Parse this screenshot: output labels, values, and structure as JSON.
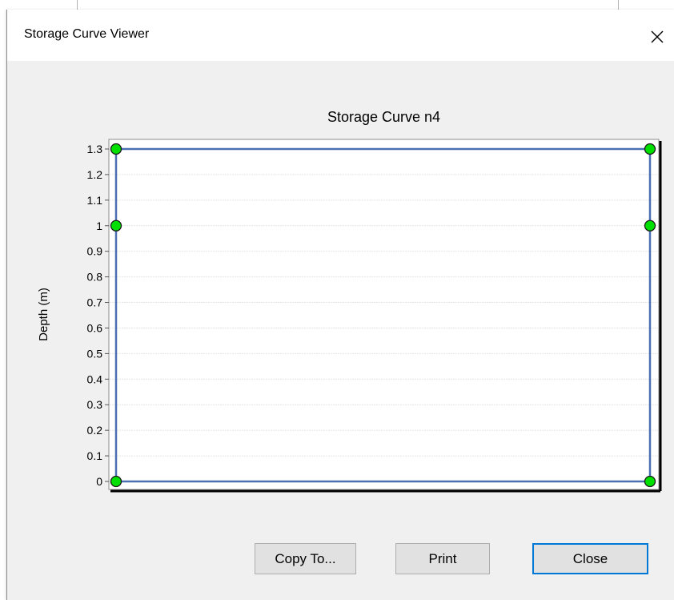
{
  "window": {
    "title": "Storage Curve Viewer",
    "close_icon": "close-icon"
  },
  "chart_data": {
    "type": "line",
    "title": "Storage Curve n4",
    "ylabel": "Depth (m)",
    "xlabel": "",
    "ylim": [
      0,
      1.3
    ],
    "y_ticks": [
      "0",
      "0.1",
      "0.2",
      "0.3",
      "0.4",
      "0.5",
      "0.6",
      "0.7",
      "0.8",
      "0.9",
      "1",
      "1.1",
      "1.2",
      "1.3"
    ],
    "grid": true,
    "series": [
      {
        "color": "#4a6fb3",
        "marker_color": "#00e000",
        "points": [
          {
            "x": "left",
            "y": 0
          },
          {
            "x": "left",
            "y": 1
          },
          {
            "x": "left",
            "y": 1.3
          },
          {
            "x": "right",
            "y": 1.3
          },
          {
            "x": "right",
            "y": 1
          },
          {
            "x": "right",
            "y": 0
          }
        ]
      }
    ]
  },
  "buttons": {
    "copy_label": "Copy To...",
    "print_label": "Print",
    "close_label": "Close"
  },
  "colors": {
    "accent": "#0078d7",
    "marker": "#00e000",
    "line": "#4a6fb3"
  }
}
